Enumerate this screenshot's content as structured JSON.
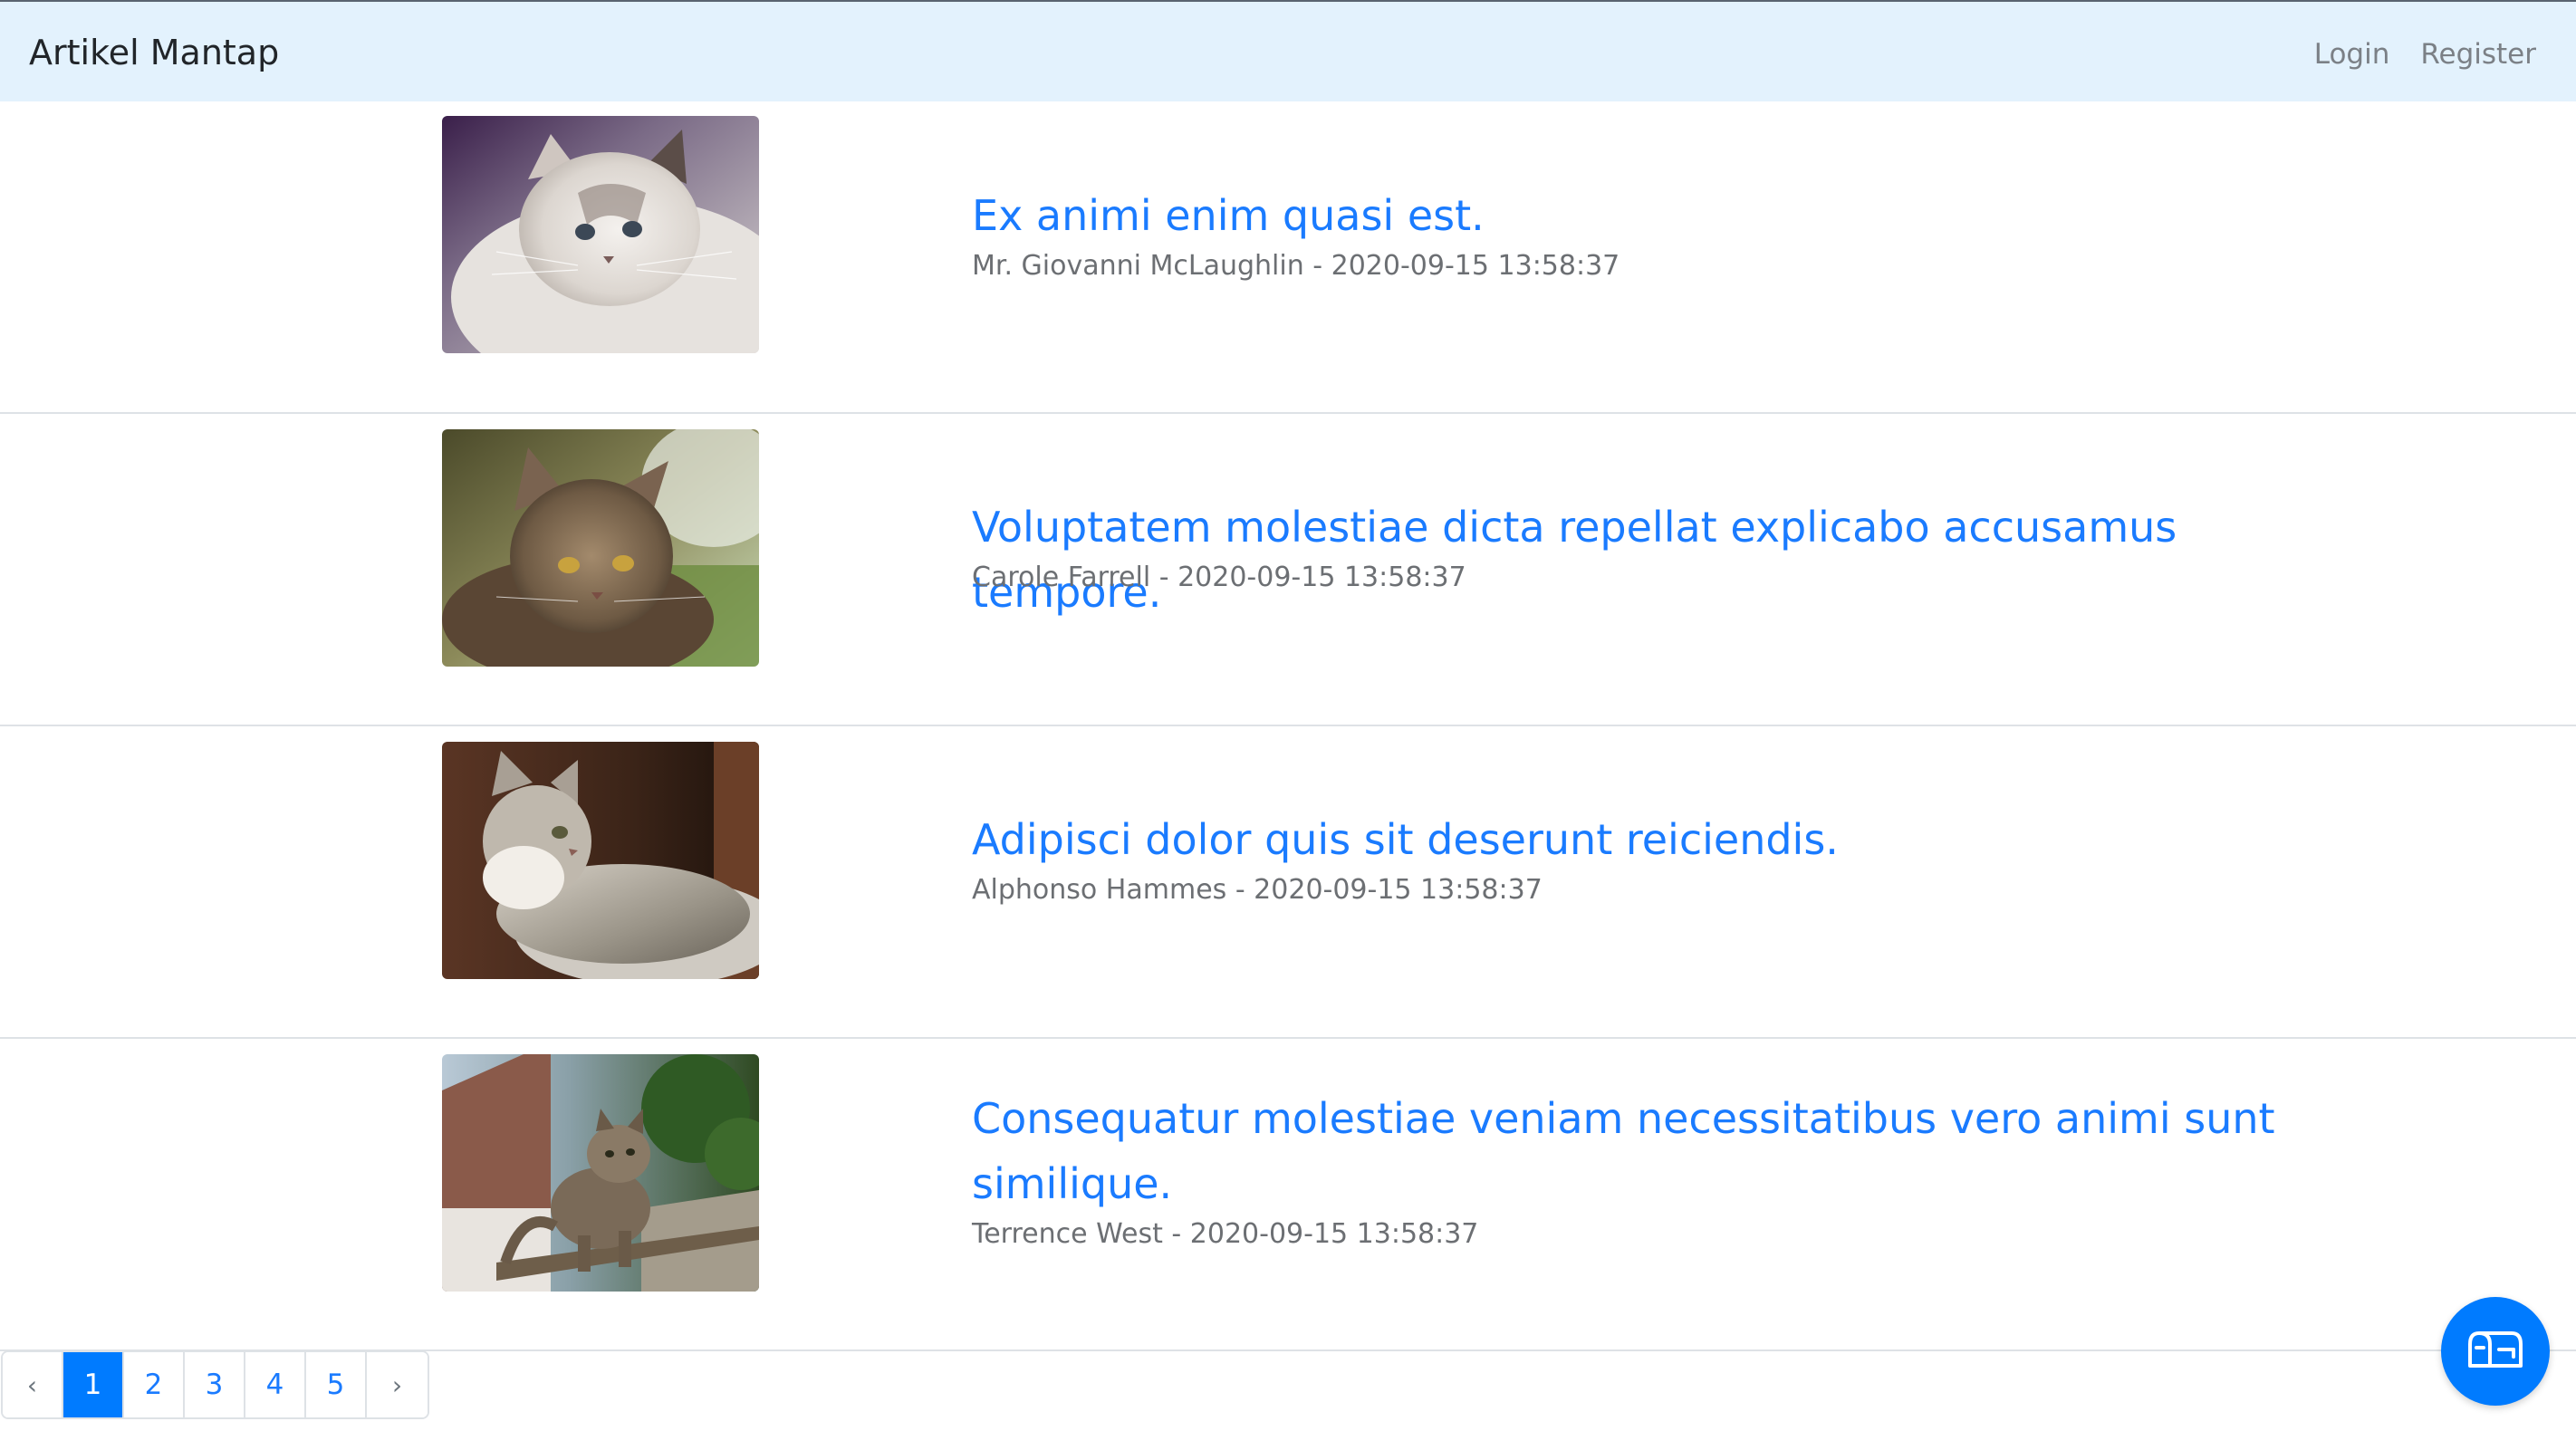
{
  "navbar": {
    "brand": "Artikel Mantap",
    "links": [
      "Login",
      "Register"
    ]
  },
  "articles": [
    {
      "title": "Ex animi enim quasi est.",
      "author": "Mr. Giovanni McLaughlin",
      "date": "2020-09-15 13:58:37",
      "meta": "Mr. Giovanni McLaughlin - 2020-09-15 13:58:37",
      "image": "white-longhair-cat-photo"
    },
    {
      "title": "Voluptatem molestiae dicta repellat explicabo accusamus tempore.",
      "author": "Carole Farrell",
      "date": "2020-09-15 13:58:37",
      "meta": "Carole Farrell - 2020-09-15 13:58:37",
      "image": "brown-tabby-cat-grass-photo"
    },
    {
      "title": "Adipisci dolor quis sit deserunt reiciendis.",
      "author": "Alphonso Hammes",
      "date": "2020-09-15 13:58:37",
      "meta": "Alphonso Hammes - 2020-09-15 13:58:37",
      "image": "grey-tabby-cat-lying-photo"
    },
    {
      "title": "Consequatur molestiae veniam necessitatibus vero animi sunt similique.",
      "author": "Terrence West",
      "date": "2020-09-15 13:58:37",
      "meta": "Terrence West - 2020-09-15 13:58:37",
      "image": "tabby-cat-walking-fence-photo"
    }
  ],
  "pagination": {
    "prev": "‹",
    "pages": [
      "1",
      "2",
      "3",
      "4",
      "5"
    ],
    "next": "›",
    "current": "1"
  },
  "fab": {
    "icon": "mailbox-icon"
  },
  "colors": {
    "navbar_bg": "#e3f2fd",
    "link": "#1a7bff",
    "primary": "#007bff",
    "muted": "#6c6f73"
  }
}
